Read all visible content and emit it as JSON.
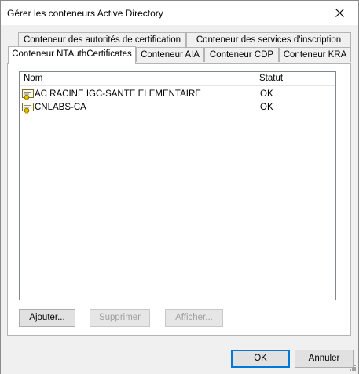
{
  "window": {
    "title": "Gérer les conteneurs Active Directory"
  },
  "tabs": {
    "row1": [
      {
        "label": "Conteneur des autorités de certification"
      },
      {
        "label": "Conteneur des services d'inscription"
      }
    ],
    "row2": [
      {
        "label": "Conteneur NTAuthCertificates",
        "selected": true
      },
      {
        "label": "Conteneur AIA"
      },
      {
        "label": "Conteneur CDP"
      },
      {
        "label": "Conteneur KRA"
      }
    ]
  },
  "list": {
    "columns": [
      "Nom",
      "Statut"
    ],
    "rows": [
      {
        "name": "AC RACINE IGC-SANTE ELEMENTAIRE",
        "status": "OK",
        "icon": "certificate-icon"
      },
      {
        "name": "CNLABS-CA",
        "status": "OK",
        "icon": "certificate-icon"
      }
    ]
  },
  "buttons": {
    "add": "Ajouter...",
    "remove": "Supprimer",
    "view": "Afficher...",
    "ok": "OK",
    "cancel": "Annuler"
  },
  "colors": {
    "focus": "#0078d7",
    "panel_bg": "#ffffff",
    "window_bg": "#f0f0f0"
  }
}
